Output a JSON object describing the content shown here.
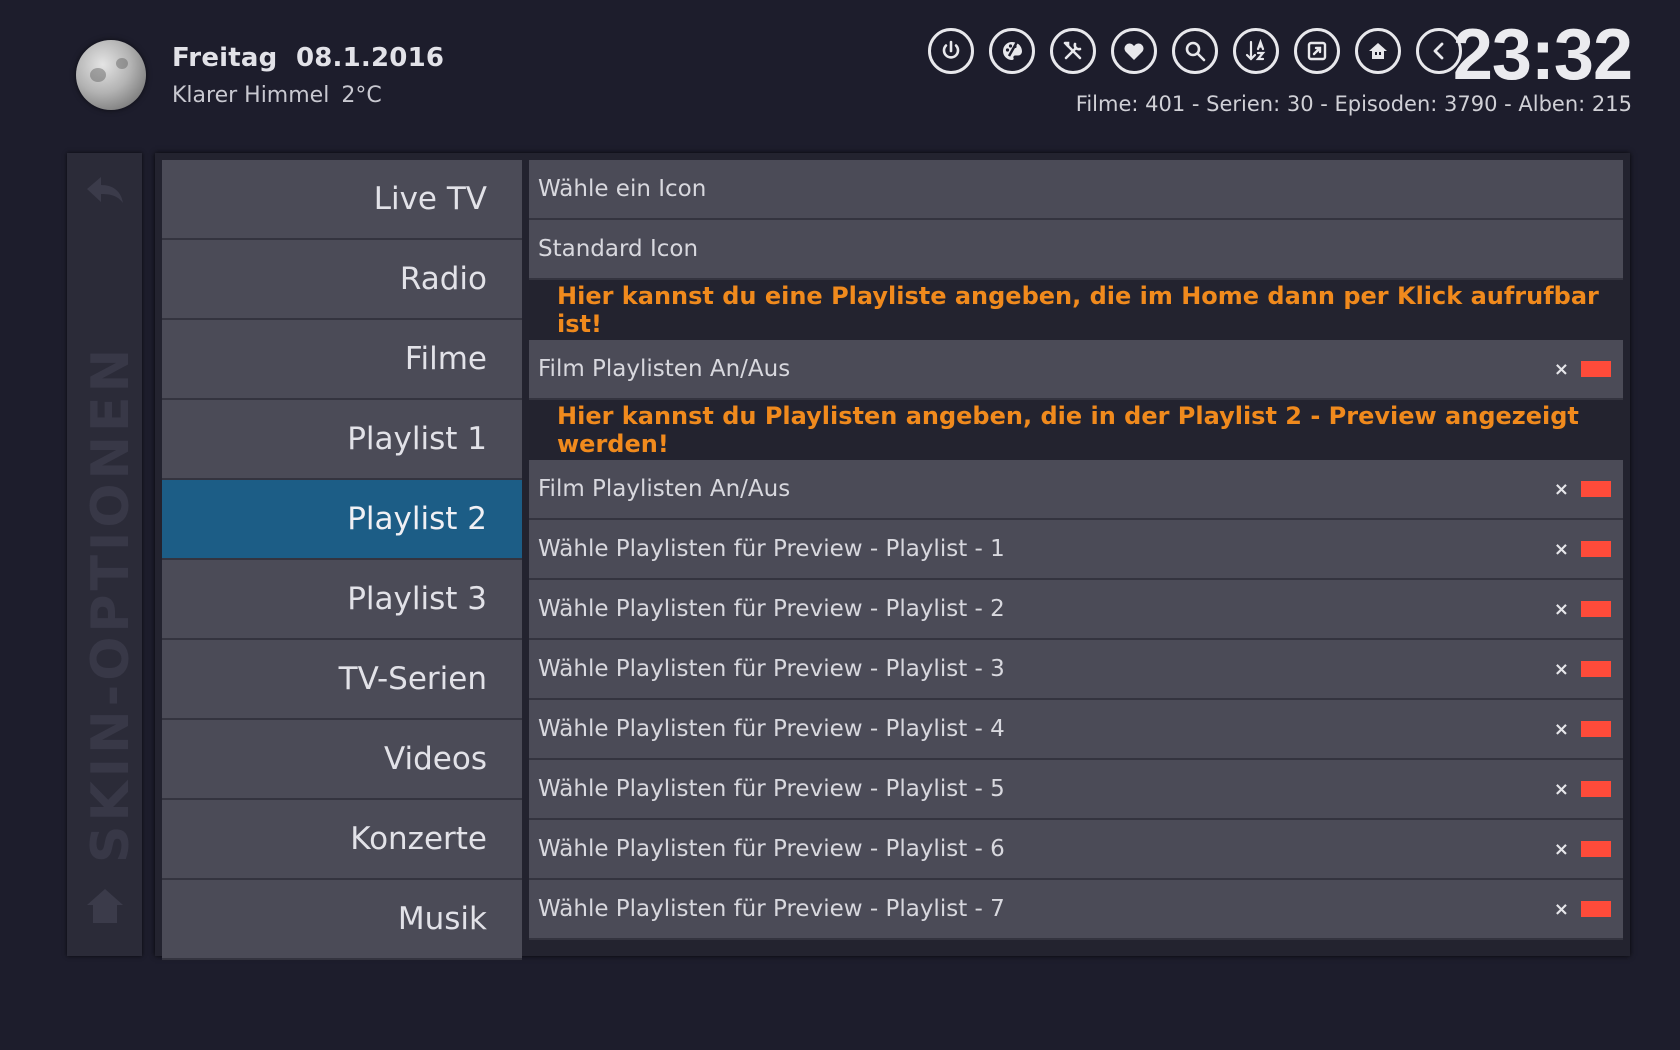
{
  "header": {
    "date_day": "Freitag",
    "date": "08.1.2016",
    "weather_desc": "Klarer Himmel",
    "temperature": "2°C",
    "clock": "23:32",
    "stats": "Filme: 401 - Serien: 30 - Episoden: 3790 - Alben: 215",
    "icons": [
      "power-icon",
      "skin-palette-icon",
      "tools-icon",
      "favourites-heart-icon",
      "search-icon",
      "sort-az-icon",
      "screenshot-icon",
      "home-house-icon",
      "back-arrow-icon"
    ]
  },
  "sidebar": {
    "label": "SKIN-OPTIONEN"
  },
  "menu": {
    "items": [
      {
        "label": "Live TV"
      },
      {
        "label": "Radio"
      },
      {
        "label": "Filme"
      },
      {
        "label": "Playlist 1"
      },
      {
        "label": "Playlist 2",
        "active": true
      },
      {
        "label": "Playlist 3"
      },
      {
        "label": "TV-Serien"
      },
      {
        "label": "Videos"
      },
      {
        "label": "Konzerte"
      },
      {
        "label": "Musik"
      }
    ]
  },
  "content": {
    "row_icon": "Wähle ein Icon",
    "row_standard_icon": "Standard Icon",
    "info_1": "Hier kannst du eine Playliste angeben, die im Home dann per Klick aufrufbar ist!",
    "row_toggle_1": "Film Playlisten An/Aus",
    "info_2": "Hier kannst du Playlisten angeben, die in der Playlist 2 - Preview angezeigt werden!",
    "row_toggle_2": "Film Playlisten An/Aus",
    "preview_rows": [
      "Wähle Playlisten für Preview - Playlist - 1",
      "Wähle Playlisten für Preview - Playlist - 2",
      "Wähle Playlisten für Preview - Playlist - 3",
      "Wähle Playlisten für Preview - Playlist - 4",
      "Wähle Playlisten für Preview - Playlist - 5",
      "Wähle Playlisten für Preview - Playlist - 6",
      "Wähle Playlisten für Preview - Playlist - 7"
    ],
    "remove_glyph": "×",
    "toggle_off_color": "#ff4b3a",
    "info_color": "#f08a1d",
    "accent_color": "#1c5d86"
  }
}
